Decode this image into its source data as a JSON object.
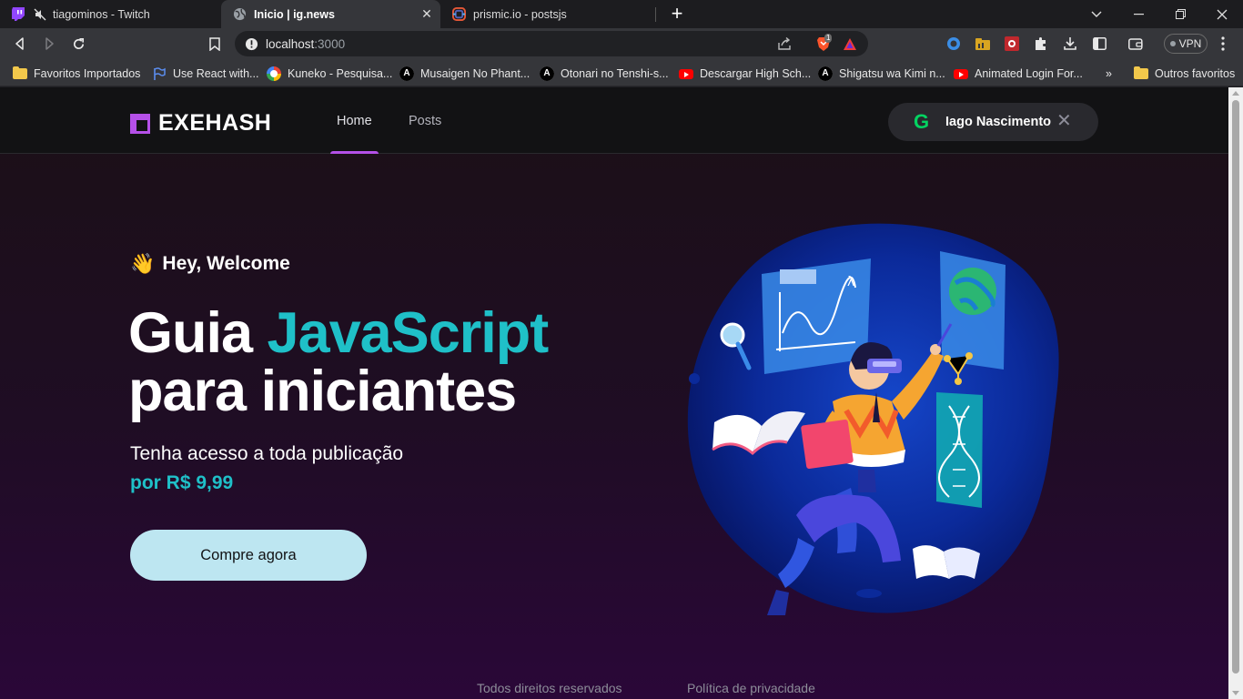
{
  "browser": {
    "tabs": [
      {
        "label": "tiagominos - Twitch",
        "icon": "twitch-icon",
        "active": false
      },
      {
        "label": "Inicio | ig.news",
        "icon": "globe-icon",
        "active": true
      },
      {
        "label": "prismic.io - postsjs",
        "icon": "prismic-icon",
        "active": false
      }
    ],
    "address": {
      "host": "localhost",
      "port": ":3000"
    },
    "shield_badge": "1",
    "vpn_label": "VPN",
    "bookmarks": [
      {
        "label": "Favoritos Importados",
        "icon": "folder-icon"
      },
      {
        "label": "Use React with...",
        "icon": "flag-icon"
      },
      {
        "label": "Kuneko - Pesquisa...",
        "icon": "google-icon"
      },
      {
        "label": "Musaigen No Phant...",
        "icon": "anime-a-icon"
      },
      {
        "label": "Otonari no Tenshi-s...",
        "icon": "anime-a-icon"
      },
      {
        "label": "Descargar High Sch...",
        "icon": "youtube-icon"
      },
      {
        "label": "Shigatsu wa Kimi n...",
        "icon": "anime-a-icon"
      },
      {
        "label": "Animated Login For...",
        "icon": "youtube-icon"
      }
    ],
    "bookmarks_overflow": "»",
    "other_bookmarks": "Outros favoritos"
  },
  "site": {
    "logo": "EXEHASH",
    "nav": [
      {
        "label": "Home",
        "active": true
      },
      {
        "label": "Posts",
        "active": false
      }
    ],
    "user": {
      "provider_glyph": "G",
      "name": "Iago Nascimento",
      "close": "✕"
    }
  },
  "hero": {
    "wave_emoji": "👋",
    "greeting": "Hey, Welcome",
    "title_part1": "Guia ",
    "title_highlight": "JavaScript",
    "title_part2": "para iniciantes",
    "subtitle": "Tenha acesso a toda publicação",
    "price": "por R$ 9,99",
    "cta": "Compre agora"
  },
  "footer": {
    "rights": "Todos direitos reservados",
    "privacy": "Política de privacidade"
  },
  "colors": {
    "brand_purple": "#b550e8",
    "highlight_cyan": "#1fc0c8",
    "cta_bg": "#bde6f1",
    "github_green": "#04d361"
  }
}
